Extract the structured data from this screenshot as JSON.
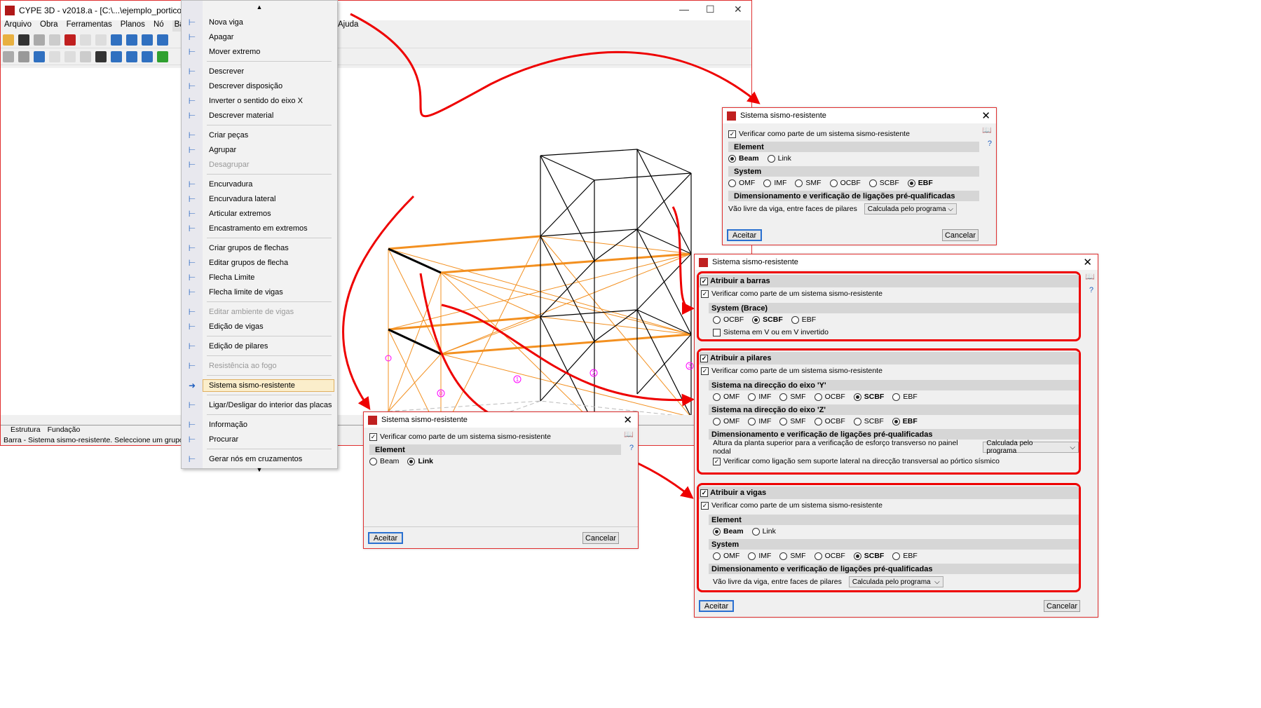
{
  "window": {
    "title": "CYPE 3D - v2018.a - [C:\\...\\ejemplo_portico_sismor",
    "min": "—",
    "max": "☐",
    "close": "✕"
  },
  "menubar": [
    "Arquivo",
    "Obra",
    "Ferramentas",
    "Planos",
    "Nó",
    "Barra",
    "Ajuda"
  ],
  "tabs": [
    "Estrutura",
    "Fundação"
  ],
  "status": "Barra - Sistema sismo-resistente.   Seleccione um grupo de ele",
  "node_labels": [
    "0",
    "1",
    "2",
    "3"
  ],
  "menu": {
    "items": [
      {
        "label": "Nova viga",
        "icon": "new-beam-icon"
      },
      {
        "label": "Apagar",
        "icon": "delete-icon"
      },
      {
        "label": "Mover extremo",
        "icon": "move-end-icon"
      },
      {
        "sep": true
      },
      {
        "label": "Descrever",
        "icon": "describe-icon"
      },
      {
        "label": "Descrever disposição",
        "icon": "describe-layout-icon"
      },
      {
        "label": "Inverter o sentido do eixo X",
        "icon": "invert-axis-icon"
      },
      {
        "label": "Descrever material",
        "icon": "material-icon"
      },
      {
        "sep": true
      },
      {
        "label": "Criar peças",
        "icon": "create-pieces-icon"
      },
      {
        "label": "Agrupar",
        "icon": "group-icon"
      },
      {
        "label": "Desagrupar",
        "icon": "ungroup-icon",
        "disabled": true
      },
      {
        "sep": true
      },
      {
        "label": "Encurvadura",
        "icon": "buckling-icon"
      },
      {
        "label": "Encurvadura lateral",
        "icon": "lateral-buckling-icon"
      },
      {
        "label": "Articular extremos",
        "icon": "hinge-icon"
      },
      {
        "label": "Encastramento em extremos",
        "icon": "fixity-icon"
      },
      {
        "sep": true
      },
      {
        "label": "Criar grupos de flechas",
        "icon": "deflection-group-icon"
      },
      {
        "label": "Editar grupos de flecha",
        "icon": "edit-deflection-icon"
      },
      {
        "label": "Flecha Limite",
        "icon": "deflection-limit-icon"
      },
      {
        "label": "Flecha limite de vigas",
        "icon": "beam-deflection-icon"
      },
      {
        "sep": true
      },
      {
        "label": "Editar ambiente de vigas",
        "icon": "beam-env-icon",
        "disabled": true
      },
      {
        "label": "Edição de vigas",
        "icon": "beam-edit-icon"
      },
      {
        "sep": true
      },
      {
        "label": "Edição de pilares",
        "icon": "column-edit-icon"
      },
      {
        "sep": true
      },
      {
        "label": "Resistência ao fogo",
        "icon": "fire-icon",
        "disabled": true
      },
      {
        "sep": true
      },
      {
        "label": "Sistema sismo-resistente",
        "icon": "arrow-icon",
        "selected": true
      },
      {
        "sep": true
      },
      {
        "label": "Ligar/Desligar do interior das placas",
        "icon": "plates-icon"
      },
      {
        "sep": true
      },
      {
        "label": "Informação",
        "icon": "info-icon"
      },
      {
        "label": "Procurar",
        "icon": "search-icon"
      },
      {
        "sep": true
      },
      {
        "label": "Gerar nós em cruzamentos",
        "icon": "nodes-icon"
      }
    ]
  },
  "dlg1": {
    "title": "Sistema sismo-resistente",
    "verify": "Verificar como parte de um sistema sismo-resistente",
    "element": "Element",
    "beam": "Beam",
    "link": "Link",
    "system": "System",
    "systems": [
      "OMF",
      "IMF",
      "SMF",
      "OCBF",
      "SCBF",
      "EBF"
    ],
    "selected_system": "EBF",
    "dim": "Dimensionamento e verificação de ligações pré-qualificadas",
    "span_label": "Vão livre da viga, entre faces de pilares",
    "span_value": "Calculada pelo programa",
    "ok": "Aceitar",
    "cancel": "Cancelar"
  },
  "dlg2": {
    "title": "Sistema sismo-resistente",
    "verify": "Verificar como parte de um sistema sismo-resistente",
    "element": "Element",
    "beam": "Beam",
    "link": "Link",
    "selected": "Link",
    "ok": "Aceitar",
    "cancel": "Cancelar"
  },
  "dlg3": {
    "title": "Sistema sismo-resistente",
    "barras": {
      "title": "Atribuir a barras",
      "verify": "Verificar como parte de um sistema sismo-resistente",
      "system": "System (Brace)",
      "options": [
        "OCBF",
        "SCBF",
        "EBF"
      ],
      "selected": "SCBF",
      "v": "Sistema em V ou em V invertido"
    },
    "pilares": {
      "title": "Atribuir a pilares",
      "verify": "Verificar como parte de um sistema sismo-resistente",
      "sysY": "Sistema na direcção do eixo 'Y'",
      "sysZ": "Sistema na direcção do eixo 'Z'",
      "options": [
        "OMF",
        "IMF",
        "SMF",
        "OCBF",
        "SCBF",
        "EBF"
      ],
      "selY": "SCBF",
      "selZ": "EBF",
      "dim": "Dimensionamento e verificação de ligações pré-qualificadas",
      "height_label": "Altura da planta superior para a verificação de esforço transverso no painel nodal",
      "height_value": "Calculada pelo programa",
      "lateral": "Verificar como ligação sem suporte lateral na direcção transversal ao pórtico sísmico"
    },
    "vigas": {
      "title": "Atribuir a vigas",
      "verify": "Verificar como parte de um sistema sismo-resistente",
      "element": "Element",
      "beam": "Beam",
      "link": "Link",
      "system": "System",
      "options": [
        "OMF",
        "IMF",
        "SMF",
        "OCBF",
        "SCBF",
        "EBF"
      ],
      "selected": "SCBF",
      "dim": "Dimensionamento e verificação de ligações pré-qualificadas",
      "span_label": "Vão livre da viga, entre faces de pilares",
      "span_value": "Calculada pelo programa"
    },
    "ok": "Aceitar",
    "cancel": "Cancelar"
  },
  "colors": {
    "accent_red": "#e00000",
    "frame_orange": "#ff8c00",
    "node_label": "#ff00ff"
  }
}
